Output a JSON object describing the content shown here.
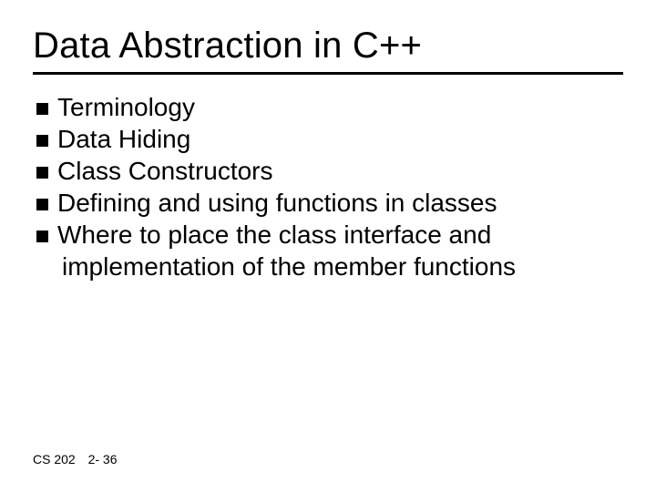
{
  "title": "Data Abstraction in C++",
  "bullets": [
    "Terminology",
    "Data Hiding",
    "Class Constructors",
    "Defining and using functions in classes",
    "Where to place the class interface and implementation of the member functions"
  ],
  "footer": {
    "course": "CS 202",
    "page": "2- 36"
  }
}
